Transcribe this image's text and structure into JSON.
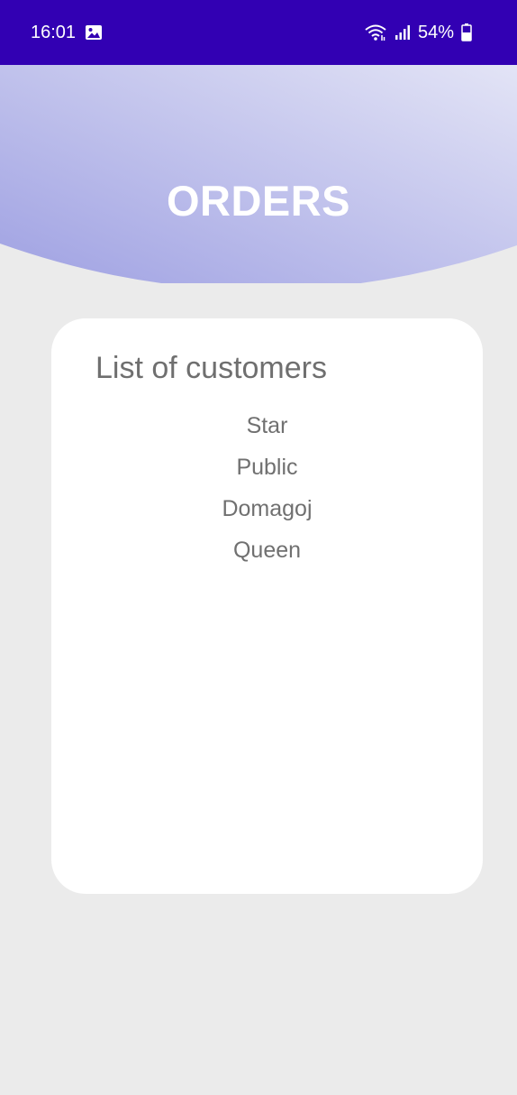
{
  "status_bar": {
    "time": "16:01",
    "battery": "54%",
    "icons": [
      "gallery-icon",
      "wifi-icon",
      "signal-icon",
      "battery-icon"
    ],
    "background": "#3200b3"
  },
  "header": {
    "title": "ORDERS",
    "gradient_start": "#a2a4e3",
    "gradient_end": "#dfe0f5"
  },
  "card": {
    "title": "List of customers",
    "customers": [
      "Star",
      "Public",
      "Domagoj",
      "Queen"
    ]
  },
  "colors": {
    "page_background": "#ebebeb",
    "card_background": "#ffffff",
    "text_gray": "#707070"
  }
}
